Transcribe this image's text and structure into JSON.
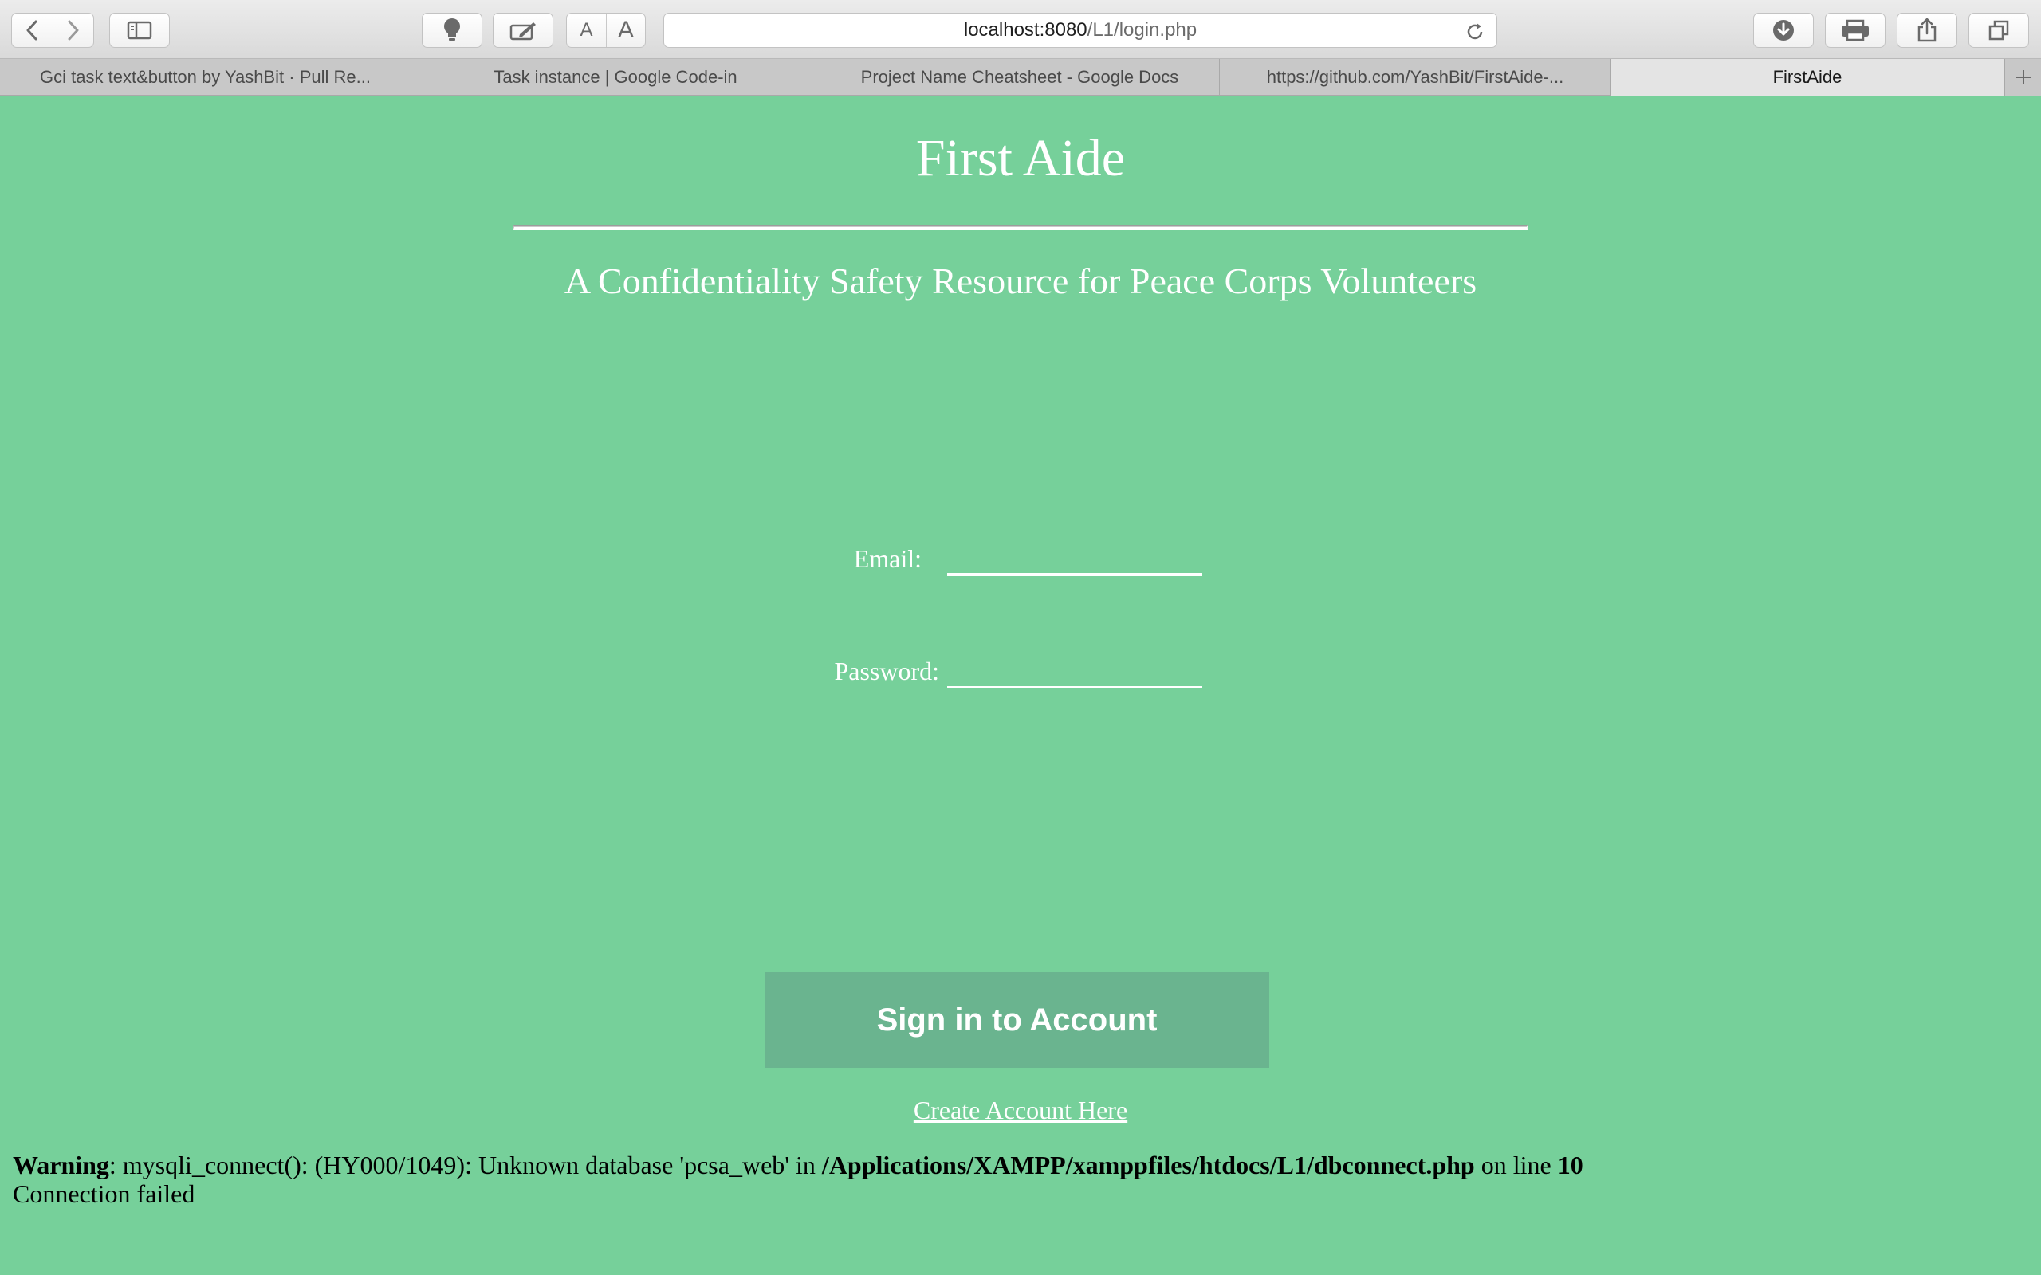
{
  "browser": {
    "url_host": "localhost:8080",
    "url_path": "/L1/login.php",
    "font_small_label": "A",
    "font_large_label": "A",
    "tabs": [
      {
        "label": "Gci task text&button by YashBit · Pull Re..."
      },
      {
        "label": "Task instance | Google Code-in"
      },
      {
        "label": "Project Name Cheatsheet - Google Docs"
      },
      {
        "label": "https://github.com/YashBit/FirstAide-..."
      },
      {
        "label": "FirstAide"
      }
    ],
    "active_tab_index": 4
  },
  "page": {
    "title": "First Aide",
    "tagline": "A Confidentiality Safety Resource for Peace Corps Volunteers",
    "email_label": "Email:",
    "email_value": "",
    "password_label": "Password:",
    "password_value": "",
    "signin_label": "Sign in to Account",
    "create_account_label": "Create Account Here",
    "colors": {
      "background": "#76d09a",
      "button": "#6ab48f",
      "text": "#ffffff"
    }
  },
  "php_error": {
    "level": "Warning",
    "message": ": mysqli_connect(): (HY000/1049): Unknown database 'pcsa_web' in ",
    "file": "/Applications/XAMPP/xamppfiles/htdocs/L1/dbconnect.php",
    "line_text": " on line ",
    "line": "10",
    "status": "Connection failed"
  }
}
